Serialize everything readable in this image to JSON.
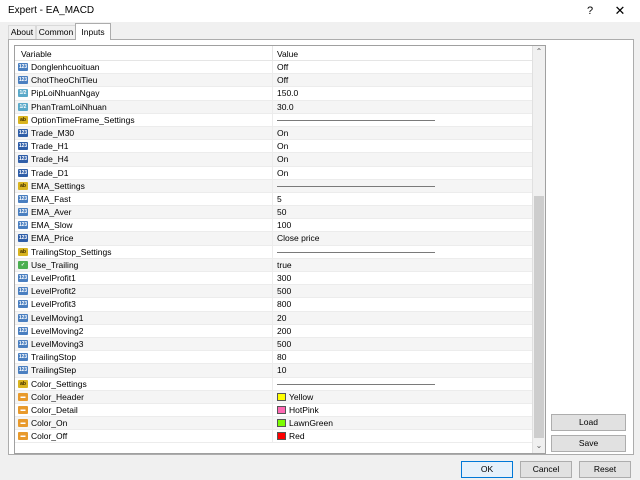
{
  "window": {
    "title": "Expert - EA_MACD",
    "help_label": "?",
    "close_label": "✕"
  },
  "tabs": [
    {
      "label": "About",
      "active": false
    },
    {
      "label": "Common",
      "active": false
    },
    {
      "label": "Inputs",
      "active": true
    }
  ],
  "grid": {
    "col_variable": "Variable",
    "col_value": "Value",
    "rows": [
      {
        "type": "t-int",
        "icon": "123",
        "name": "Donglenhcuoituan",
        "value": "Off"
      },
      {
        "type": "t-int",
        "icon": "123",
        "name": "ChotTheoChiTieu",
        "value": "Off"
      },
      {
        "type": "t-dbl",
        "icon": "1/2",
        "name": "PipLoiNhuanNgay",
        "value": "150.0"
      },
      {
        "type": "t-dbl",
        "icon": "1/2",
        "name": "PhanTramLoiNhuan",
        "value": "30.0"
      },
      {
        "type": "t-str",
        "icon": "ab",
        "name": "OptionTimeFrame_Settings",
        "value": "",
        "separator": true
      },
      {
        "type": "t-enum",
        "icon": "123",
        "name": "Trade_M30",
        "value": "On"
      },
      {
        "type": "t-enum",
        "icon": "123",
        "name": "Trade_H1",
        "value": "On"
      },
      {
        "type": "t-enum",
        "icon": "123",
        "name": "Trade_H4",
        "value": "On"
      },
      {
        "type": "t-enum",
        "icon": "123",
        "name": "Trade_D1",
        "value": "On"
      },
      {
        "type": "t-str",
        "icon": "ab",
        "name": "EMA_Settings",
        "value": "",
        "separator": true
      },
      {
        "type": "t-int",
        "icon": "123",
        "name": "EMA_Fast",
        "value": "5"
      },
      {
        "type": "t-int",
        "icon": "123",
        "name": "EMA_Aver",
        "value": "50"
      },
      {
        "type": "t-int",
        "icon": "123",
        "name": "EMA_Slow",
        "value": "100"
      },
      {
        "type": "t-enum",
        "icon": "123",
        "name": "EMA_Price",
        "value": "Close price"
      },
      {
        "type": "t-str",
        "icon": "ab",
        "name": "TrailingStop_Settings",
        "value": "",
        "separator": true
      },
      {
        "type": "t-bool",
        "icon": "✓",
        "name": "Use_Trailing",
        "value": "true"
      },
      {
        "type": "t-int",
        "icon": "123",
        "name": "LevelProfit1",
        "value": "300"
      },
      {
        "type": "t-int",
        "icon": "123",
        "name": "LevelProfit2",
        "value": "500"
      },
      {
        "type": "t-int",
        "icon": "123",
        "name": "LevelProfit3",
        "value": "800"
      },
      {
        "type": "t-int",
        "icon": "123",
        "name": "LevelMoving1",
        "value": "20"
      },
      {
        "type": "t-int",
        "icon": "123",
        "name": "LevelMoving2",
        "value": "200"
      },
      {
        "type": "t-int",
        "icon": "123",
        "name": "LevelMoving3",
        "value": "500"
      },
      {
        "type": "t-int",
        "icon": "123",
        "name": "TrailingStop",
        "value": "80"
      },
      {
        "type": "t-int",
        "icon": "123",
        "name": "TrailingStep",
        "value": "10"
      },
      {
        "type": "t-str",
        "icon": "ab",
        "name": "Color_Settings",
        "value": "",
        "separator": true
      },
      {
        "type": "t-clr",
        "icon": "▬",
        "name": "Color_Header",
        "value": "Yellow",
        "color": "#ffff00"
      },
      {
        "type": "t-clr",
        "icon": "▬",
        "name": "Color_Detail",
        "value": "HotPink",
        "color": "#ff69b4"
      },
      {
        "type": "t-clr",
        "icon": "▬",
        "name": "Color_On",
        "value": "LawnGreen",
        "color": "#7cfc00"
      },
      {
        "type": "t-clr",
        "icon": "▬",
        "name": "Color_Off",
        "value": "Red",
        "color": "#ff0000"
      }
    ]
  },
  "scrollbar": {
    "up_glyph": "⌃",
    "down_glyph": "⌄"
  },
  "buttons": {
    "load": "Load",
    "save": "Save",
    "ok": "OK",
    "cancel": "Cancel",
    "reset": "Reset"
  }
}
